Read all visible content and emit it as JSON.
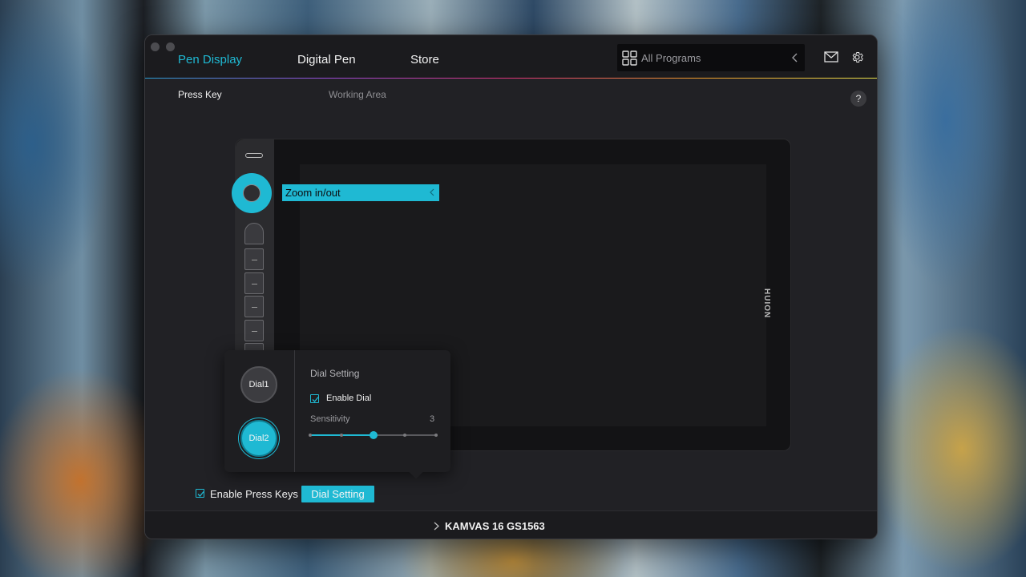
{
  "colors": {
    "accent": "#1fb9d3",
    "window_bg": "#212125"
  },
  "header": {
    "tabs": [
      {
        "label": "Pen Display",
        "active": true
      },
      {
        "label": "Digital Pen",
        "active": false
      },
      {
        "label": "Store",
        "active": false
      }
    ],
    "program_selector": {
      "label": "All Programs",
      "icon": "grid-icon"
    },
    "icons": [
      "mail-icon",
      "gear-icon"
    ]
  },
  "subtabs": [
    {
      "label": "Press Key",
      "active": true
    },
    {
      "label": "Working Area",
      "active": false
    }
  ],
  "help": {
    "label": "?"
  },
  "tablet": {
    "brand": "HUION",
    "dial_action": "Zoom in/out"
  },
  "dial_popover": {
    "dials": [
      {
        "label": "Dial1",
        "selected": false
      },
      {
        "label": "Dial2",
        "selected": true
      }
    ],
    "title": "Dial Setting",
    "enable_dial": {
      "label": "Enable Dial",
      "checked": true
    },
    "sensitivity": {
      "label": "Sensitivity",
      "value": 3,
      "min": 1,
      "max": 5
    }
  },
  "bottom": {
    "enable_press_keys": {
      "label": "Enable Press Keys",
      "checked": true
    },
    "dial_setting_button": "Dial Setting"
  },
  "footer": {
    "device": "KAMVAS 16 GS1563"
  }
}
